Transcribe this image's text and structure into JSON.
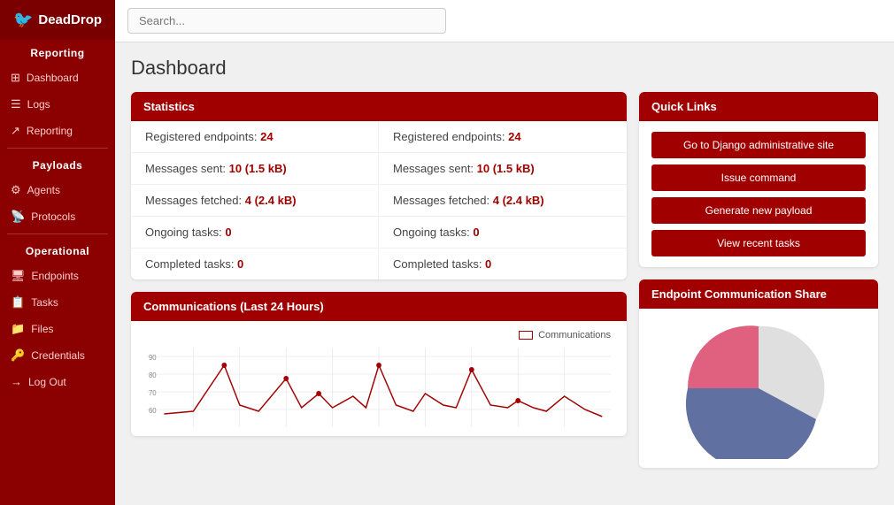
{
  "app": {
    "name": "DeadDrop",
    "logo_icon": "🐦"
  },
  "sidebar": {
    "sections": [
      {
        "label": "Reporting",
        "items": [
          {
            "id": "dashboard",
            "label": "Dashboard",
            "icon": "⊞"
          },
          {
            "id": "logs",
            "label": "Logs",
            "icon": "☰"
          },
          {
            "id": "reporting",
            "label": "Reporting",
            "icon": "↗"
          }
        ]
      },
      {
        "label": "Payloads",
        "items": [
          {
            "id": "agents",
            "label": "Agents",
            "icon": "⚙"
          },
          {
            "id": "protocols",
            "label": "Protocols",
            "icon": "📡"
          }
        ]
      },
      {
        "label": "Operational",
        "items": [
          {
            "id": "endpoints",
            "label": "Endpoints",
            "icon": "🖥"
          },
          {
            "id": "tasks",
            "label": "Tasks",
            "icon": "📋"
          },
          {
            "id": "files",
            "label": "Files",
            "icon": "📁"
          },
          {
            "id": "credentials",
            "label": "Credentials",
            "icon": "🔑"
          },
          {
            "id": "logout",
            "label": "Log Out",
            "icon": "→"
          }
        ]
      }
    ]
  },
  "header": {
    "search_placeholder": "Search..."
  },
  "page": {
    "title": "Dashboard"
  },
  "statistics": {
    "title": "Statistics",
    "items": [
      {
        "label": "Registered endpoints:",
        "value": "24",
        "suffix": ""
      },
      {
        "label": "Registered endpoints:",
        "value": "24",
        "suffix": ""
      },
      {
        "label": "Messages sent:",
        "value": "10",
        "suffix": " (1.5 kB)"
      },
      {
        "label": "Messages sent:",
        "value": "10",
        "suffix": " (1.5 kB)"
      },
      {
        "label": "Messages fetched:",
        "value": "4",
        "suffix": " (2.4 kB)"
      },
      {
        "label": "Messages fetched:",
        "value": "4",
        "suffix": " (2.4 kB)"
      },
      {
        "label": "Ongoing tasks:",
        "value": "0",
        "suffix": ""
      },
      {
        "label": "Ongoing tasks:",
        "value": "0",
        "suffix": ""
      },
      {
        "label": "Completed tasks:",
        "value": "0",
        "suffix": ""
      },
      {
        "label": "Completed tasks:",
        "value": "0",
        "suffix": ""
      }
    ]
  },
  "quick_links": {
    "title": "Quick Links",
    "buttons": [
      "Go to Django administrative site",
      "Issue command",
      "Generate new payload",
      "View recent tasks"
    ]
  },
  "communications": {
    "title": "Communications (Last 24 Hours)",
    "legend": "Communications",
    "y_labels": [
      "90",
      "80",
      "70",
      "60"
    ]
  },
  "endpoint_share": {
    "title": "Endpoint Communication Share"
  }
}
